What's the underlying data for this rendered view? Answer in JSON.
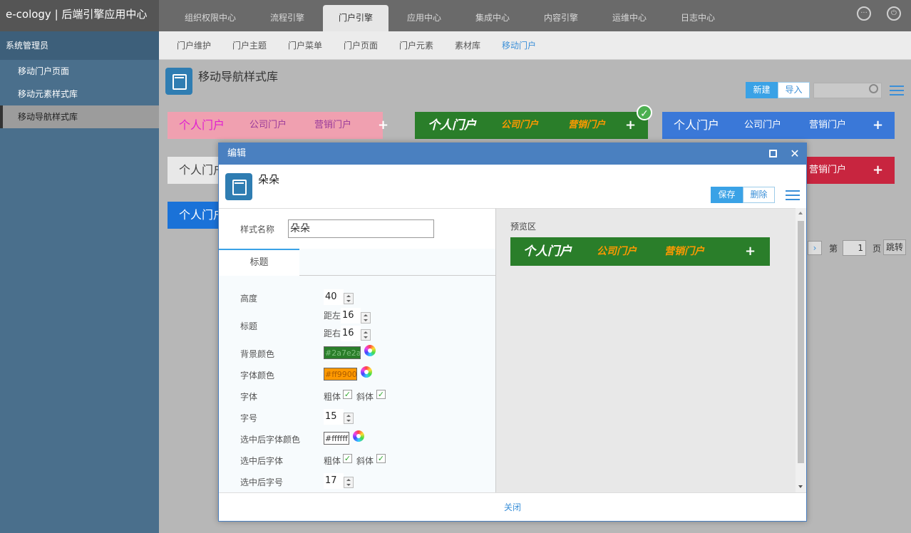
{
  "app": {
    "brand": "e-cology | 后端引擎应用中心"
  },
  "top_tabs": [
    "组织权限中心",
    "流程引擎",
    "门户引擎",
    "应用中心",
    "集成中心",
    "内容引擎",
    "运维中心",
    "日志中心"
  ],
  "sidebar": {
    "header": "系统管理员",
    "items": [
      "移动门户页面",
      "移动元素样式库",
      "移动导航样式库"
    ]
  },
  "sub_tabs": [
    "门户维护",
    "门户主题",
    "门户菜单",
    "门户页面",
    "门户元素",
    "素材库",
    "移动门户"
  ],
  "page": {
    "title": "移动导航样式库",
    "new_label": "新建",
    "import_label": "导入"
  },
  "cards": [
    {
      "bg": "#f0a0b0",
      "tabs": [
        "个人门户",
        "公司门户",
        "营销门户"
      ],
      "colors": [
        "#e020d0",
        "#9a3a9a",
        "#9a3a9a"
      ],
      "plus": "+"
    },
    {
      "bg": "#2a7e2a",
      "tabs": [
        "个人门户",
        "公司门户",
        "营销门户"
      ],
      "colors": [
        "#ffffff",
        "#ff9900",
        "#ff9900"
      ],
      "plus": "+"
    },
    {
      "bg": "#3a78d8",
      "tabs": [
        "个人门户",
        "公司门户",
        "营销门户"
      ],
      "colors": [
        "#ffffff",
        "#ffffff",
        "#ffffff"
      ],
      "plus": "+"
    },
    {
      "bg": "#e8e8e8",
      "tabs": [
        "个人门户"
      ],
      "colors": [
        "#444444"
      ],
      "plus": ""
    },
    {
      "bg": "#c8253f",
      "tabs": [
        "营销门户"
      ],
      "colors": [
        "#ffffff"
      ],
      "plus": "+"
    },
    {
      "bg": "#1a72d8",
      "tabs": [
        "个人门户"
      ],
      "colors": [
        "#ffffff"
      ],
      "plus": ""
    }
  ],
  "pager": {
    "prefix": "第",
    "page": "1",
    "suffix": "页",
    "jump": "跳转"
  },
  "modal": {
    "title": "编辑",
    "name": "朵朵",
    "save": "保存",
    "delete": "删除",
    "style_name_label": "样式名称",
    "style_name_value": "朵朵",
    "tab": "标题",
    "preview_label": "预览区",
    "close": "关闭",
    "fields": {
      "height_label": "高度",
      "height": "40",
      "title_label": "标题",
      "left_label": "距左",
      "left": "16",
      "right_label": "距右",
      "right": "16",
      "bg_label": "背景颜色",
      "bg_value": "#2a7e2a",
      "font_color_label": "字体颜色",
      "font_color_value": "#ff9900",
      "font_label": "字体",
      "bold": "粗体",
      "italic": "斜体",
      "size_label": "字号",
      "size": "15",
      "sel_color_label": "选中后字体颜色",
      "sel_color_value": "#ffffff",
      "sel_font_label": "选中后字体",
      "sel_size_label": "选中后字号",
      "sel_size": "17"
    },
    "preview": {
      "tabs": [
        "个人门户",
        "公司门户",
        "营销门户"
      ],
      "plus": "+"
    }
  },
  "colors": {
    "accent": "#3aa2e6",
    "modal_header": "#4a80c0",
    "preview_bg": "#2a7e2a",
    "preview_font": "#ff9900"
  }
}
